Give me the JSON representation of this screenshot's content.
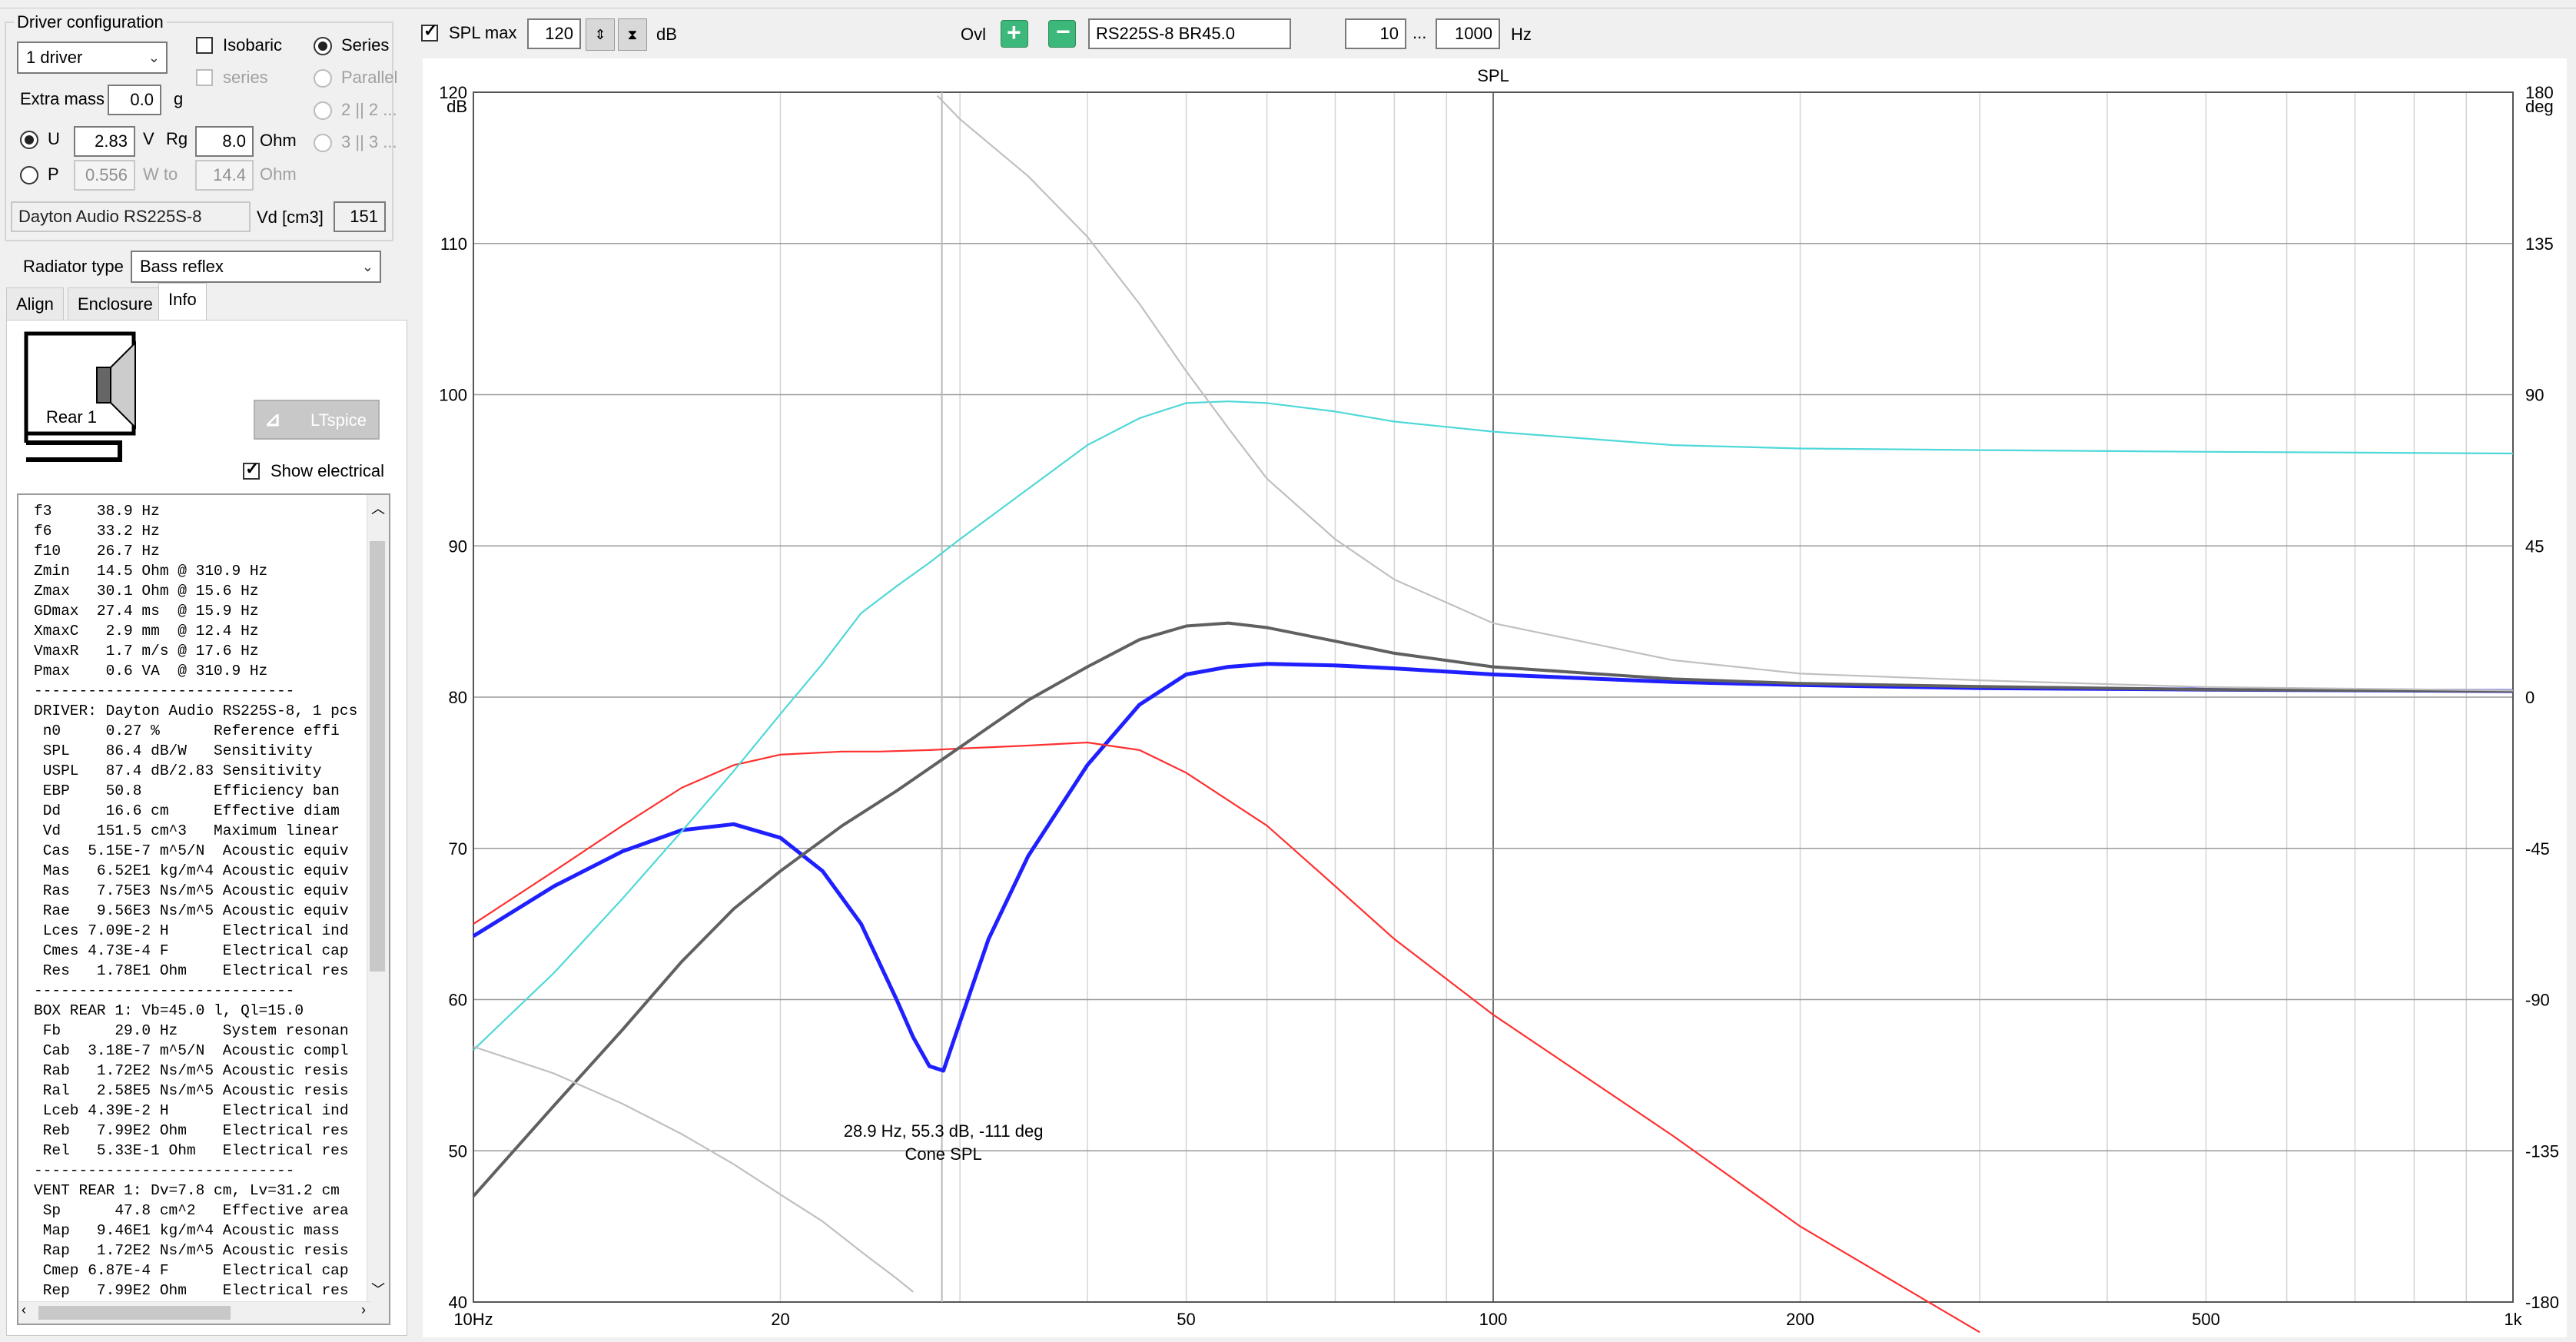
{
  "driver_config": {
    "title": "Driver configuration",
    "drivers_select": "1 driver",
    "isobaric_label": "Isobaric",
    "series_label": "Series",
    "series_sub_label": "series",
    "parallel_label": "Parallel",
    "config_2x2": "2 || 2 ...",
    "config_3x3": "3 || 3 ...",
    "extra_mass_label": "Extra mass",
    "extra_mass_value": "0.0",
    "extra_mass_unit": "g",
    "u_label": "U",
    "u_value": "2.83",
    "u_unit": "V",
    "rg_label": "Rg",
    "rg_value": "8.0",
    "rg_unit": "Ohm",
    "p_label": "P",
    "p_value": "0.556",
    "p_unit": "W to",
    "p_ohm_value": "14.4",
    "p_ohm_unit": "Ohm",
    "driver_name": "Dayton Audio RS225S-8",
    "vd_label": "Vd [cm3]",
    "vd_value": "151"
  },
  "radiator": {
    "label": "Radiator type",
    "value": "Bass reflex"
  },
  "tabs": [
    "Align",
    "Enclosure",
    "Info"
  ],
  "info": {
    "diagram_label": "Rear 1",
    "ltspice_label": "LTspice",
    "show_electrical_label": "Show electrical",
    "lines": [
      "f3     38.9 Hz",
      "f6     33.2 Hz",
      "f10    26.7 Hz",
      "Zmin   14.5 Ohm @ 310.9 Hz",
      "Zmax   30.1 Ohm @ 15.6 Hz",
      "GDmax  27.4 ms  @ 15.9 Hz",
      "XmaxC   2.9 mm  @ 12.4 Hz",
      "VmaxR   1.7 m/s @ 17.6 Hz",
      "Pmax    0.6 VA  @ 310.9 Hz",
      "-----------------------------",
      "DRIVER: Dayton Audio RS225S-8, 1 pcs",
      " n0     0.27 %      Reference effi",
      " SPL    86.4 dB/W   Sensitivity",
      " USPL   87.4 dB/2.83 Sensitivity",
      " EBP    50.8        Efficiency ban",
      " Dd     16.6 cm     Effective diam",
      " Vd    151.5 cm^3   Maximum linear",
      " Cas  5.15E-7 m^5/N  Acoustic equiv",
      " Mas   6.52E1 kg/m^4 Acoustic equiv",
      " Ras   7.75E3 Ns/m^5 Acoustic equiv",
      " Rae   9.56E3 Ns/m^5 Acoustic equiv",
      " Lces 7.09E-2 H      Electrical ind",
      " Cmes 4.73E-4 F      Electrical cap",
      " Res   1.78E1 Ohm    Electrical res",
      "-----------------------------",
      "BOX REAR 1: Vb=45.0 l, Ql=15.0",
      " Fb      29.0 Hz     System resonan",
      " Cab  3.18E-7 m^5/N  Acoustic compl",
      " Rab   1.72E2 Ns/m^5 Acoustic resis",
      " Ral   2.58E5 Ns/m^5 Acoustic resis",
      " Lceb 4.39E-2 H      Electrical ind",
      " Reb   7.99E2 Ohm    Electrical res",
      " Rel   5.33E-1 Ohm   Electrical res",
      "-----------------------------",
      "VENT REAR 1: Dv=7.8 cm, Lv=31.2 cm",
      " Sp      47.8 cm^2   Effective area",
      " Map   9.46E1 kg/m^4 Acoustic mass",
      " Rap   1.72E2 Ns/m^5 Acoustic resis",
      " Cmep 6.87E-4 F      Electrical cap",
      " Rep   7.99E2 Ohm    Electrical res"
    ]
  },
  "toolbar": {
    "spl_max_label": "SPL max",
    "spl_max_value": "120",
    "db_unit": "dB",
    "ovl_label": "Ovl",
    "ovl_name": "RS225S-8 BR45.0",
    "freq_from": "10",
    "freq_sep": "...",
    "freq_to": "1000",
    "hz_unit": "Hz"
  },
  "chart_data": {
    "type": "line",
    "title": "SPL",
    "x_scale": "log",
    "xlim": [
      10,
      1000
    ],
    "ylim_left": [
      40,
      120
    ],
    "ylim_right": [
      -180,
      180
    ],
    "ylabel_left": "dB",
    "ylabel_right": "deg",
    "x_ticks": [
      "10Hz",
      "20",
      "50",
      "100",
      "200",
      "500",
      "1k"
    ],
    "y_ticks_left": [
      "120",
      "110",
      "100",
      "90",
      "80",
      "70",
      "60",
      "50",
      "40"
    ],
    "y_ticks_right": [
      "180",
      "135",
      "90",
      "45",
      "0",
      "-45",
      "-90",
      "-135",
      "-180"
    ],
    "grid": true,
    "cursor_x": 28.9,
    "marker_x": 29.0,
    "annotation": {
      "line1": "28.9 Hz, 55.3 dB, -111 deg",
      "line2": "Cone SPL"
    },
    "series": [
      {
        "color": "#2020ff",
        "axis": "left",
        "x": [
          10,
          12,
          14,
          16,
          18,
          20,
          22,
          24,
          26,
          27,
          28,
          28.9,
          30,
          32,
          35,
          40,
          45,
          50,
          55,
          60,
          70,
          80,
          100,
          150,
          200,
          300,
          500,
          1000
        ],
        "y": [
          64.2,
          67.5,
          69.8,
          71.2,
          71.6,
          70.7,
          68.5,
          65,
          60,
          57.5,
          55.6,
          55.3,
          58.5,
          64,
          69.5,
          75.5,
          79.5,
          81.5,
          82.0,
          82.2,
          82.1,
          81.9,
          81.5,
          81.0,
          80.8,
          80.6,
          80.5,
          80.4
        ]
      },
      {
        "color": "#ff3030",
        "axis": "left",
        "x": [
          10,
          12,
          14,
          16,
          18,
          20,
          23,
          25,
          28,
          30,
          35,
          40,
          45,
          50,
          60,
          70,
          80,
          100,
          150,
          200,
          300
        ],
        "y": [
          65,
          68.5,
          71.5,
          74,
          75.5,
          76.2,
          76.4,
          76.4,
          76.5,
          76.6,
          76.8,
          77,
          76.5,
          75,
          71.5,
          67.5,
          64,
          59,
          51,
          45,
          38
        ]
      },
      {
        "color": "#606060",
        "axis": "left",
        "x": [
          10,
          12,
          14,
          16,
          18,
          20,
          23,
          26,
          29,
          32,
          35,
          40,
          45,
          50,
          55,
          60,
          70,
          80,
          100,
          150,
          200,
          300,
          500,
          1000
        ],
        "y": [
          47,
          53,
          58,
          62.5,
          66,
          68.5,
          71.5,
          73.8,
          76,
          78,
          79.8,
          82,
          83.8,
          84.7,
          84.9,
          84.6,
          83.7,
          82.9,
          82,
          81.2,
          80.9,
          80.7,
          80.5,
          80.4
        ]
      },
      {
        "color": "#50d8d8",
        "axis": "right",
        "x": [
          10,
          12,
          14,
          16,
          18,
          20,
          22,
          24,
          26,
          28,
          30,
          35,
          40,
          45,
          50,
          55,
          60,
          70,
          80,
          100,
          150,
          200,
          300,
          500,
          1000
        ],
        "y": [
          -105,
          -82,
          -60,
          -40,
          -22,
          -5,
          10,
          25,
          33,
          40,
          47,
          62,
          75,
          83,
          87.5,
          88,
          87.5,
          85,
          82,
          79,
          75,
          74,
          73.5,
          73,
          72.5
        ]
      },
      {
        "color": "#c0c0c0",
        "axis": "right",
        "x": [
          10,
          12,
          14,
          16,
          18,
          20,
          22,
          24,
          26,
          27
        ],
        "y": [
          -104,
          -112,
          -121,
          -130,
          -139,
          -148,
          -156,
          -165,
          -173,
          -177
        ]
      },
      {
        "color": "#c0c0c0",
        "axis": "right",
        "x": [
          28.5,
          30,
          35,
          40,
          45,
          50,
          55,
          60,
          70,
          80,
          100,
          150,
          200,
          300,
          500,
          1000
        ],
        "y": [
          179,
          172,
          155,
          137,
          117,
          97,
          80,
          65,
          47,
          35,
          22,
          11,
          7,
          5,
          3,
          2
        ]
      }
    ]
  }
}
